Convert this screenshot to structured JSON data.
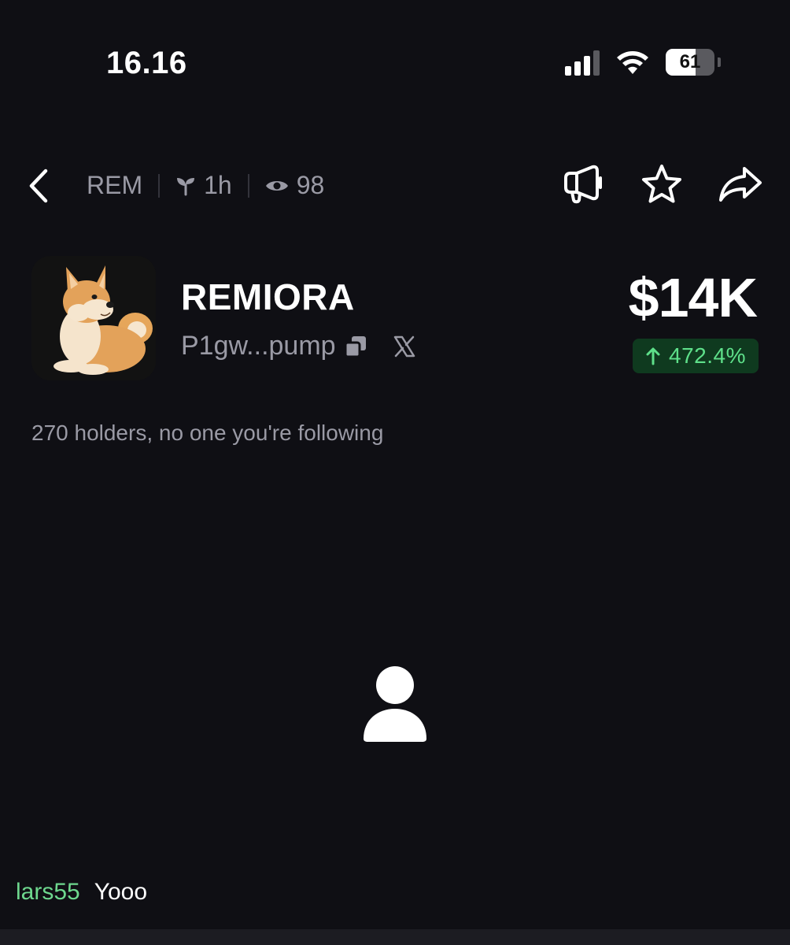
{
  "status_bar": {
    "time": "16.16",
    "battery": "61",
    "battery_level_percent": 61
  },
  "header": {
    "ticker": "REM",
    "age": "1h",
    "views": "98",
    "icons": {
      "back": "chevron-left-icon",
      "age": "sprout-icon",
      "views": "eye-icon",
      "announce": "megaphone-icon",
      "favorite": "star-icon",
      "share": "share-arrow-icon"
    }
  },
  "token": {
    "name": "REMIORA",
    "address": "P1gw...pump",
    "market_cap": "$14K",
    "change": "472.4%",
    "change_direction": "up",
    "change_color": "#5ee08a",
    "holders_text": "270 holders, no one you're following"
  },
  "chat": {
    "username": "lars55",
    "message": "Yooo"
  },
  "colors": {
    "background": "#0f0f14",
    "muted_text": "#9a9aa5",
    "positive": "#5ee08a",
    "positive_bg": "#0f3a1f",
    "username": "#6ed78e"
  }
}
